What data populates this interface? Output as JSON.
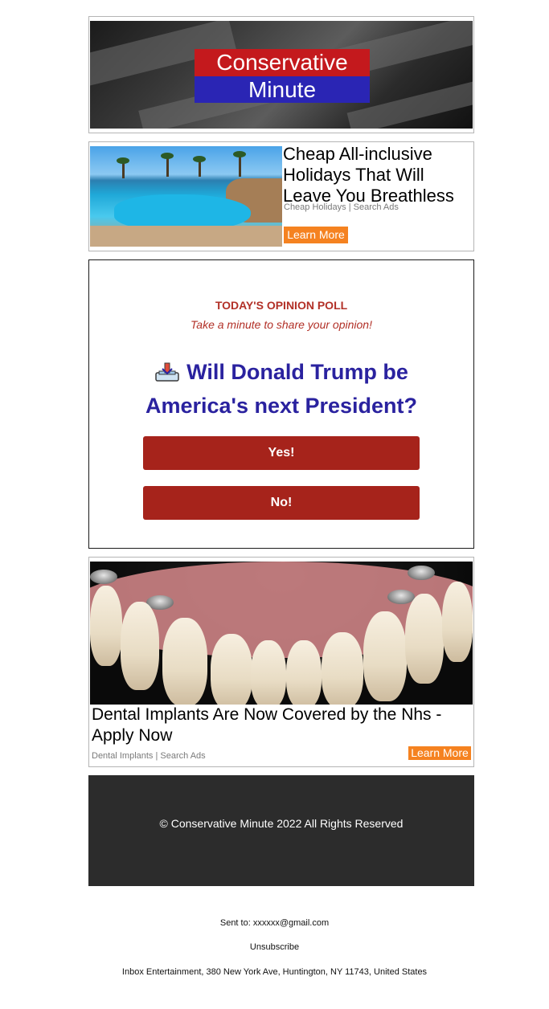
{
  "header": {
    "logo_line1": "Conservative",
    "logo_line2": "Minute",
    "logo_colors": {
      "top": "#c4191d",
      "bottom": "#2a25b4"
    }
  },
  "ad1": {
    "title": "Cheap All-inclusive Holidays That Will Leave You Breathless",
    "source": "Cheap Holidays | Search Ads",
    "button": "Learn More"
  },
  "poll": {
    "kicker": "TODAY'S OPINION POLL",
    "subtitle": "Take a minute to share your opinion!",
    "question": "Will Donald Trump be America's next President?",
    "question_icon": "ballot-box-icon",
    "options": [
      "Yes!",
      "No!"
    ]
  },
  "ad2": {
    "title": "Dental Implants Are Now Covered by the Nhs - Apply Now",
    "source": "Dental Implants | Search Ads",
    "button": "Learn More"
  },
  "footer": {
    "copyright": "© Conservative Minute 2022 All Rights Reserved"
  },
  "meta": {
    "sent_to": "Sent to: xxxxxx@gmail.com",
    "unsubscribe": "Unsubscribe",
    "address": "Inbox Entertainment, 380 New York Ave, Huntington, NY 11743, United States"
  },
  "colors": {
    "accent_orange": "#f58220",
    "poll_red": "#a6231b",
    "question_blue": "#2a229f",
    "footer_bg": "#2c2c2c"
  }
}
